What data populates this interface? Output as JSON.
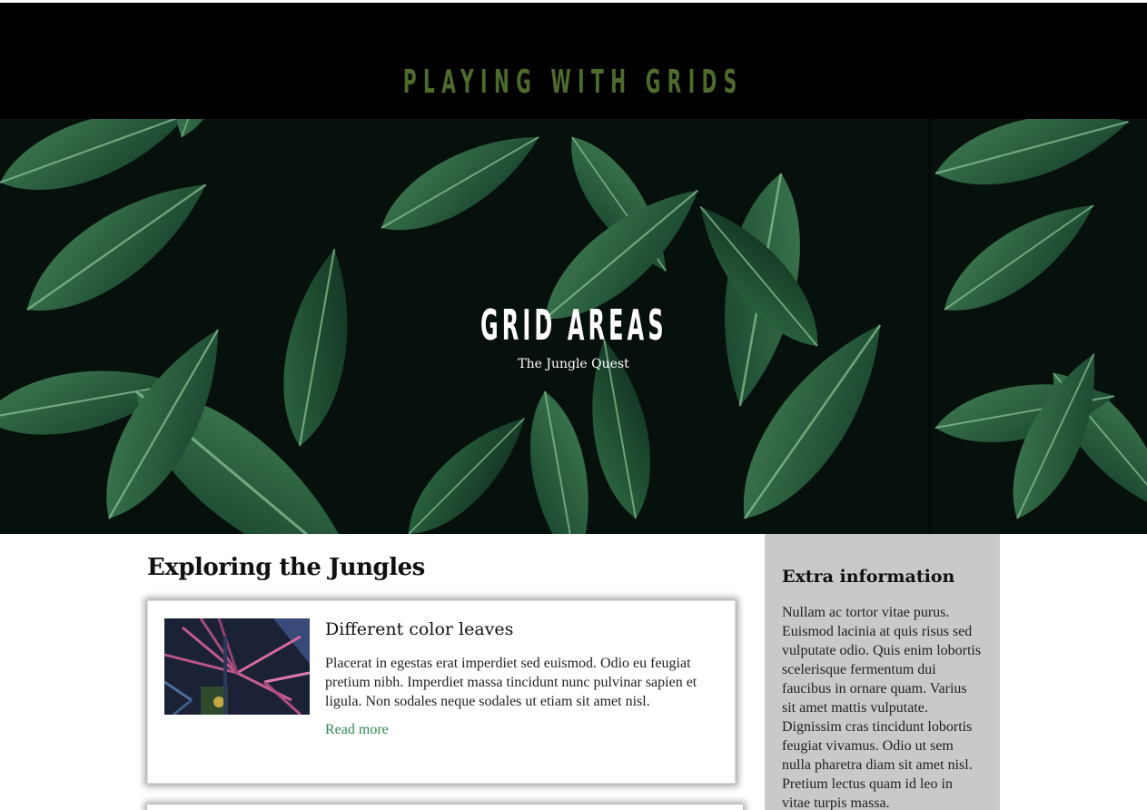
{
  "header": {
    "title": "PLAYING WITH GRIDS"
  },
  "hero": {
    "title": "GRID AREAS",
    "subtitle": "The Jungle Quest"
  },
  "main": {
    "section_title": "Exploring the Jungles",
    "cards": [
      {
        "title": "Different color leaves",
        "text": "Placerat in egestas erat imperdiet sed euismod. Odio eu feugiat pretium nibh. Imperdiet massa tincidunt nunc pulvinar sapien et ligula. Non sodales neque sodales ut etiam sit amet nisl.",
        "link": "Read more"
      }
    ]
  },
  "aside": {
    "title": "Extra information",
    "text": "Nullam ac tortor vitae purus. Euismod lacinia at quis risus sed vulputate odio. Quis enim lobortis scelerisque fermentum dui faucibus in ornare quam. Varius sit amet mattis vulputate. Dignissim cras tincidunt lobortis feugiat vivamus. Odio ut sem nulla pharetra diam sit amet nisl. Pretium lectus quam id leo in vitae turpis massa."
  },
  "colors": {
    "header_bg": "#000000",
    "header_title": "#4d6b2c",
    "link": "#2f8a4f",
    "aside_bg": "#c9c9c9"
  }
}
